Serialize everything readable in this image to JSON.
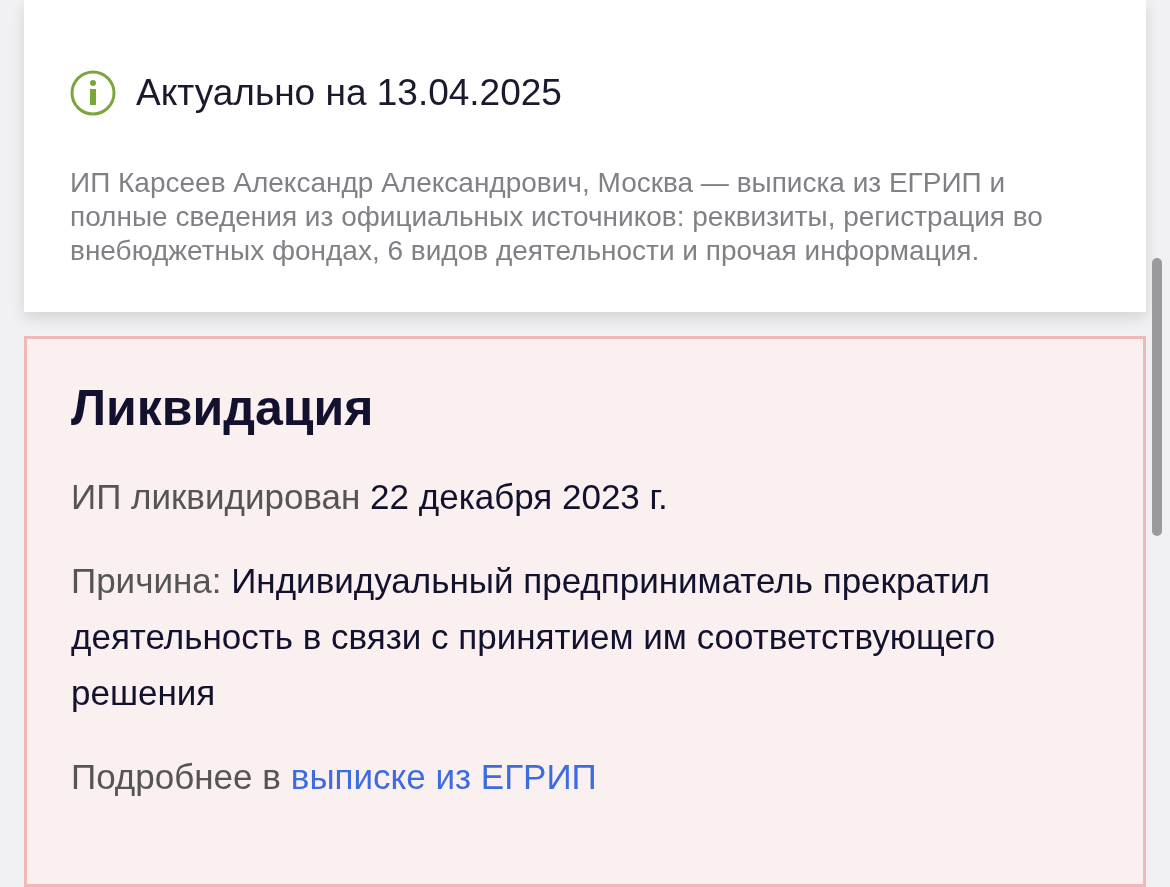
{
  "status": {
    "title": "Актуально на 13.04.2025",
    "description": "ИП Карсеев Александр Александрович, Москва — выписка из ЕГРИП и полные сведения из официальных источников: реквизиты, регистрация во внебюджетных фондах, 6 видов деятельности и прочая информация."
  },
  "liquidation": {
    "title": "Ликвидация",
    "date_text": "ИП ликвидирован **22 декабря 2023 г.**",
    "reason_text": "Причина: **Индивидуальный предприниматель прекратил деятельность в связи с принятием им соответствующего решения**",
    "more_label": "Подробнее в",
    "more_link": "выписке из ЕГРИП"
  }
}
